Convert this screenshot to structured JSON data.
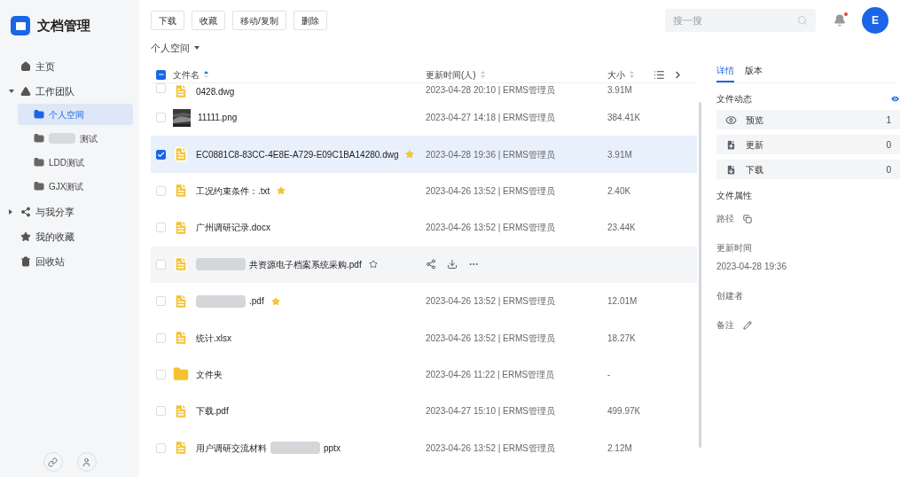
{
  "app": {
    "title": "文档管理"
  },
  "sidebar": {
    "items": [
      {
        "label": "主页",
        "kind": "home",
        "selected": false
      },
      {
        "label": "工作团队",
        "kind": "drive",
        "expanded": true,
        "selected": false,
        "children": [
          {
            "label": "个人空间",
            "blurred": false,
            "selected": true
          },
          {
            "label": "测试",
            "blurred": true,
            "selected": false
          },
          {
            "label": "LDD测试",
            "blurred": false,
            "selected": false
          },
          {
            "label": "GJX测试",
            "blurred": false,
            "selected": false
          }
        ]
      },
      {
        "label": "与我分享",
        "kind": "share",
        "expanded": false,
        "selected": false
      },
      {
        "label": "我的收藏",
        "kind": "star",
        "selected": false
      },
      {
        "label": "回收站",
        "kind": "trash",
        "selected": false
      }
    ]
  },
  "toolbar": {
    "buttons": [
      "下载",
      "收藏",
      "移动/复制",
      "删除"
    ],
    "search": {
      "placeholder": "搜一搜"
    },
    "notification_dot": true,
    "avatar": "E"
  },
  "breadcrumb": "个人空间",
  "table": {
    "select_all": {
      "indeterminate": true
    },
    "columns": [
      {
        "label": "文件名",
        "sorted": true
      },
      {
        "label": "更新时间(人)",
        "sorted": false
      },
      {
        "label": "大小",
        "sorted": false
      }
    ],
    "rows": [
      {
        "kind": "doc",
        "name": "0428.dwg",
        "redacted": false,
        "starred": false,
        "hovered": false,
        "checked": false,
        "time": "2023-04-28 20:10 | ERMS管理员",
        "size": "3.91M"
      },
      {
        "name": "11111.png",
        "redacted": false,
        "starred": false,
        "hovered": false,
        "checked": false,
        "time": "2023-04-27 14:18 | ERMS管理员",
        "size": "384.41K"
      },
      {
        "kind": "doc",
        "name": "EC0881C8-83CC-4E8E-A729-E09C1BA14280.dwg",
        "redacted": false,
        "starred": true,
        "hovered": false,
        "checked": true,
        "time": "2023-04-28 19:36 | ERMS管理员",
        "size": "3.91M"
      },
      {
        "kind": "doc",
        "name": "工况约束条件：.txt",
        "redacted": false,
        "starred": true,
        "hovered": false,
        "checked": false,
        "time": "2023-04-26 13:52 | ERMS管理员",
        "size": "2.40K"
      },
      {
        "kind": "doc",
        "name": "广州调研记录.docx",
        "redacted": false,
        "starred": false,
        "hovered": false,
        "checked": false,
        "time": "2023-04-26 13:52 | ERMS管理员",
        "size": "23.44K"
      },
      {
        "kind": "doc",
        "name": "共资源电子档案系统采购.pdf",
        "redacted": true,
        "starred": false,
        "hovered": true,
        "checked": false
      },
      {
        "kind": "doc",
        "name": ".pdf",
        "redacted": true,
        "starred": true,
        "hovered": false,
        "checked": false,
        "time": "2023-04-26 13:52 | ERMS管理员",
        "size": "12.01M"
      },
      {
        "kind": "doc",
        "name": "统计.xlsx",
        "redacted": false,
        "starred": false,
        "hovered": false,
        "checked": false,
        "time": "2023-04-26 13:52 | ERMS管理员",
        "size": "18.27K"
      },
      {
        "kind": "folder",
        "name": "文件夹",
        "redacted": false,
        "starred": false,
        "hovered": false,
        "checked": false,
        "time": "2023-04-26 11:22 | ERMS管理员",
        "size": "-"
      },
      {
        "kind": "doc",
        "name": "下载.pdf",
        "redacted": false,
        "starred": false,
        "hovered": false,
        "checked": false,
        "time": "2023-04-27 15:10 | ERMS管理员",
        "size": "499.97K"
      },
      {
        "kind": "doc",
        "name": "用户调研交流材料",
        "name_end": "pptx",
        "redacted": true,
        "starred": false,
        "hovered": false,
        "checked": false,
        "time": "2023-04-26 13:52 | ERMS管理员",
        "size": "2.12M"
      }
    ]
  },
  "detail": {
    "tabs": [
      {
        "label": "详情",
        "selected": true
      },
      {
        "label": "版本",
        "selected": false
      }
    ],
    "activity_title": "文件动态",
    "activity": [
      {
        "kind": "preview",
        "label": "预览",
        "count": "1"
      },
      {
        "kind": "update",
        "label": "更新",
        "count": "0"
      },
      {
        "kind": "download",
        "label": "下载",
        "count": "0"
      }
    ],
    "properties_title": "文件属性",
    "properties": [
      {
        "kind": "copy",
        "label": "路径"
      },
      {
        "kind": "plain",
        "label": "更新时间",
        "value": "2023-04-28 19:36"
      },
      {
        "kind": "plain",
        "label": "创建者"
      },
      {
        "kind": "edit",
        "label": "备注"
      }
    ]
  }
}
